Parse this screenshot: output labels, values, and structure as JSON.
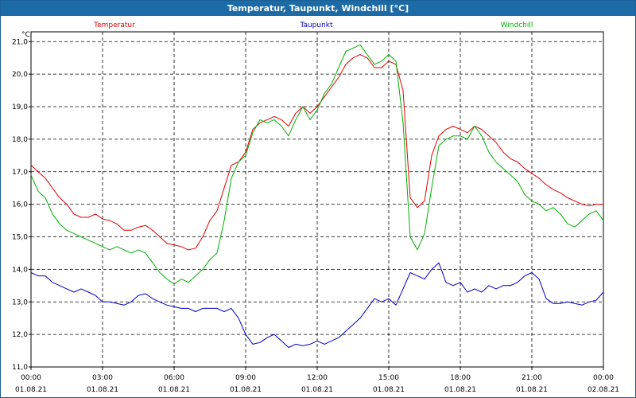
{
  "window": {
    "title": "Temperatur, Taupunkt, Windchill [°C]"
  },
  "chart_data": {
    "type": "line",
    "title": "Temperatur, Taupunkt, Windchill [°C]",
    "ylabel": "°C",
    "xlabel": "",
    "ylim": [
      11.0,
      21.3
    ],
    "xlim_hours": [
      0,
      24
    ],
    "y_ticks": [
      "11,0",
      "12,0",
      "13,0",
      "14,0",
      "15,0",
      "16,0",
      "17,0",
      "18,0",
      "19,0",
      "20,0",
      "21,0"
    ],
    "x_ticks": [
      {
        "time": "00:00",
        "date": "01.08.21"
      },
      {
        "time": "03:00",
        "date": "01.08.21"
      },
      {
        "time": "06:00",
        "date": "01.08.21"
      },
      {
        "time": "09:00",
        "date": "01.08.21"
      },
      {
        "time": "12:00",
        "date": "01.08.21"
      },
      {
        "time": "15:00",
        "date": "01.08.21"
      },
      {
        "time": "18:00",
        "date": "01.08.21"
      },
      {
        "time": "21:00",
        "date": "01.08.21"
      },
      {
        "time": "00:00",
        "date": "02.08.21"
      }
    ],
    "grid": true,
    "legend_placement": "top",
    "series": [
      {
        "name": "Temperatur",
        "color": "#e00000",
        "points": [
          [
            0.0,
            17.2
          ],
          [
            0.3,
            17.0
          ],
          [
            0.6,
            16.8
          ],
          [
            0.9,
            16.5
          ],
          [
            1.2,
            16.2
          ],
          [
            1.5,
            16.0
          ],
          [
            1.8,
            15.7
          ],
          [
            2.1,
            15.6
          ],
          [
            2.4,
            15.6
          ],
          [
            2.7,
            15.7
          ],
          [
            3.0,
            15.55
          ],
          [
            3.3,
            15.5
          ],
          [
            3.6,
            15.4
          ],
          [
            3.9,
            15.2
          ],
          [
            4.2,
            15.2
          ],
          [
            4.5,
            15.3
          ],
          [
            4.8,
            15.35
          ],
          [
            5.1,
            15.2
          ],
          [
            5.4,
            15.0
          ],
          [
            5.7,
            14.8
          ],
          [
            6.0,
            14.75
          ],
          [
            6.3,
            14.7
          ],
          [
            6.6,
            14.6
          ],
          [
            6.9,
            14.65
          ],
          [
            7.2,
            15.0
          ],
          [
            7.5,
            15.5
          ],
          [
            7.8,
            15.8
          ],
          [
            8.1,
            16.5
          ],
          [
            8.4,
            17.2
          ],
          [
            8.7,
            17.3
          ],
          [
            9.0,
            17.6
          ],
          [
            9.3,
            18.3
          ],
          [
            9.6,
            18.5
          ],
          [
            9.9,
            18.6
          ],
          [
            10.2,
            18.7
          ],
          [
            10.5,
            18.6
          ],
          [
            10.8,
            18.4
          ],
          [
            11.1,
            18.8
          ],
          [
            11.4,
            19.0
          ],
          [
            11.7,
            18.8
          ],
          [
            12.0,
            19.0
          ],
          [
            12.3,
            19.3
          ],
          [
            12.6,
            19.6
          ],
          [
            12.9,
            19.9
          ],
          [
            13.2,
            20.3
          ],
          [
            13.5,
            20.5
          ],
          [
            13.8,
            20.6
          ],
          [
            14.1,
            20.5
          ],
          [
            14.4,
            20.2
          ],
          [
            14.7,
            20.2
          ],
          [
            15.0,
            20.4
          ],
          [
            15.3,
            20.3
          ],
          [
            15.6,
            19.5
          ],
          [
            15.9,
            16.2
          ],
          [
            16.2,
            15.9
          ],
          [
            16.5,
            16.1
          ],
          [
            16.8,
            17.5
          ],
          [
            17.1,
            18.1
          ],
          [
            17.4,
            18.3
          ],
          [
            17.7,
            18.4
          ],
          [
            18.0,
            18.3
          ],
          [
            18.3,
            18.2
          ],
          [
            18.6,
            18.4
          ],
          [
            18.9,
            18.3
          ],
          [
            19.2,
            18.1
          ],
          [
            19.5,
            17.9
          ],
          [
            19.8,
            17.6
          ],
          [
            20.1,
            17.4
          ],
          [
            20.4,
            17.3
          ],
          [
            20.7,
            17.1
          ],
          [
            21.0,
            16.95
          ],
          [
            21.3,
            16.8
          ],
          [
            21.6,
            16.6
          ],
          [
            21.9,
            16.45
          ],
          [
            22.2,
            16.35
          ],
          [
            22.5,
            16.2
          ],
          [
            22.8,
            16.1
          ],
          [
            23.1,
            16.0
          ],
          [
            23.4,
            15.95
          ],
          [
            23.7,
            16.0
          ],
          [
            24.0,
            16.0
          ]
        ]
      },
      {
        "name": "Taupunkt",
        "color": "#0000c0",
        "points": [
          [
            0.0,
            13.9
          ],
          [
            0.3,
            13.8
          ],
          [
            0.6,
            13.8
          ],
          [
            0.9,
            13.6
          ],
          [
            1.2,
            13.5
          ],
          [
            1.5,
            13.4
          ],
          [
            1.8,
            13.3
          ],
          [
            2.1,
            13.4
          ],
          [
            2.4,
            13.3
          ],
          [
            2.7,
            13.2
          ],
          [
            3.0,
            13.0
          ],
          [
            3.3,
            13.0
          ],
          [
            3.6,
            12.95
          ],
          [
            3.9,
            12.9
          ],
          [
            4.2,
            13.0
          ],
          [
            4.5,
            13.2
          ],
          [
            4.8,
            13.25
          ],
          [
            5.1,
            13.1
          ],
          [
            5.4,
            13.0
          ],
          [
            5.7,
            12.9
          ],
          [
            6.0,
            12.85
          ],
          [
            6.3,
            12.8
          ],
          [
            6.6,
            12.8
          ],
          [
            6.9,
            12.7
          ],
          [
            7.2,
            12.8
          ],
          [
            7.5,
            12.8
          ],
          [
            7.8,
            12.8
          ],
          [
            8.1,
            12.7
          ],
          [
            8.4,
            12.8
          ],
          [
            8.7,
            12.5
          ],
          [
            9.0,
            12.0
          ],
          [
            9.3,
            11.7
          ],
          [
            9.6,
            11.75
          ],
          [
            9.9,
            11.9
          ],
          [
            10.2,
            12.0
          ],
          [
            10.5,
            11.8
          ],
          [
            10.8,
            11.6
          ],
          [
            11.1,
            11.7
          ],
          [
            11.4,
            11.65
          ],
          [
            11.7,
            11.7
          ],
          [
            12.0,
            11.8
          ],
          [
            12.3,
            11.7
          ],
          [
            12.6,
            11.8
          ],
          [
            12.9,
            11.9
          ],
          [
            13.2,
            12.1
          ],
          [
            13.5,
            12.3
          ],
          [
            13.8,
            12.5
          ],
          [
            14.1,
            12.8
          ],
          [
            14.4,
            13.1
          ],
          [
            14.7,
            13.0
          ],
          [
            15.0,
            13.1
          ],
          [
            15.3,
            12.9
          ],
          [
            15.6,
            13.4
          ],
          [
            15.9,
            13.9
          ],
          [
            16.2,
            13.8
          ],
          [
            16.5,
            13.7
          ],
          [
            16.8,
            14.0
          ],
          [
            17.1,
            14.2
          ],
          [
            17.4,
            13.6
          ],
          [
            17.7,
            13.5
          ],
          [
            18.0,
            13.6
          ],
          [
            18.3,
            13.3
          ],
          [
            18.6,
            13.4
          ],
          [
            18.9,
            13.3
          ],
          [
            19.2,
            13.5
          ],
          [
            19.5,
            13.4
          ],
          [
            19.8,
            13.5
          ],
          [
            20.1,
            13.5
          ],
          [
            20.4,
            13.6
          ],
          [
            20.7,
            13.8
          ],
          [
            21.0,
            13.9
          ],
          [
            21.3,
            13.7
          ],
          [
            21.6,
            13.1
          ],
          [
            21.9,
            12.95
          ],
          [
            22.2,
            12.95
          ],
          [
            22.5,
            13.0
          ],
          [
            22.8,
            12.95
          ],
          [
            23.1,
            12.9
          ],
          [
            23.4,
            13.0
          ],
          [
            23.7,
            13.05
          ],
          [
            24.0,
            13.3
          ]
        ]
      },
      {
        "name": "Windchill",
        "color": "#00b000",
        "points": [
          [
            0.0,
            16.9
          ],
          [
            0.3,
            16.4
          ],
          [
            0.6,
            16.2
          ],
          [
            0.9,
            15.7
          ],
          [
            1.2,
            15.4
          ],
          [
            1.5,
            15.2
          ],
          [
            1.8,
            15.1
          ],
          [
            2.1,
            15.0
          ],
          [
            2.4,
            14.9
          ],
          [
            2.7,
            14.8
          ],
          [
            3.0,
            14.7
          ],
          [
            3.3,
            14.6
          ],
          [
            3.6,
            14.7
          ],
          [
            3.9,
            14.6
          ],
          [
            4.2,
            14.5
          ],
          [
            4.5,
            14.6
          ],
          [
            4.8,
            14.5
          ],
          [
            5.1,
            14.2
          ],
          [
            5.4,
            13.9
          ],
          [
            5.7,
            13.7
          ],
          [
            6.0,
            13.55
          ],
          [
            6.3,
            13.7
          ],
          [
            6.6,
            13.6
          ],
          [
            6.9,
            13.8
          ],
          [
            7.2,
            14.0
          ],
          [
            7.5,
            14.3
          ],
          [
            7.8,
            14.5
          ],
          [
            8.1,
            15.5
          ],
          [
            8.4,
            16.8
          ],
          [
            8.7,
            17.3
          ],
          [
            9.0,
            17.5
          ],
          [
            9.3,
            18.2
          ],
          [
            9.6,
            18.6
          ],
          [
            9.9,
            18.5
          ],
          [
            10.2,
            18.6
          ],
          [
            10.5,
            18.4
          ],
          [
            10.8,
            18.1
          ],
          [
            11.1,
            18.6
          ],
          [
            11.4,
            19.0
          ],
          [
            11.7,
            18.6
          ],
          [
            12.0,
            18.9
          ],
          [
            12.3,
            19.4
          ],
          [
            12.6,
            19.7
          ],
          [
            12.9,
            20.2
          ],
          [
            13.2,
            20.7
          ],
          [
            13.5,
            20.8
          ],
          [
            13.8,
            20.9
          ],
          [
            14.1,
            20.6
          ],
          [
            14.4,
            20.3
          ],
          [
            14.7,
            20.4
          ],
          [
            15.0,
            20.6
          ],
          [
            15.3,
            20.4
          ],
          [
            15.6,
            18.5
          ],
          [
            15.9,
            15.0
          ],
          [
            16.2,
            14.6
          ],
          [
            16.5,
            15.1
          ],
          [
            16.8,
            16.5
          ],
          [
            17.1,
            17.8
          ],
          [
            17.4,
            18.0
          ],
          [
            17.7,
            18.1
          ],
          [
            18.0,
            18.1
          ],
          [
            18.3,
            18.0
          ],
          [
            18.6,
            18.4
          ],
          [
            18.9,
            18.1
          ],
          [
            19.2,
            17.6
          ],
          [
            19.5,
            17.3
          ],
          [
            19.8,
            17.1
          ],
          [
            20.1,
            16.9
          ],
          [
            20.4,
            16.7
          ],
          [
            20.7,
            16.3
          ],
          [
            21.0,
            16.1
          ],
          [
            21.3,
            16.0
          ],
          [
            21.6,
            15.8
          ],
          [
            21.9,
            15.9
          ],
          [
            22.2,
            15.7
          ],
          [
            22.5,
            15.4
          ],
          [
            22.8,
            15.3
          ],
          [
            23.1,
            15.5
          ],
          [
            23.4,
            15.7
          ],
          [
            23.7,
            15.8
          ],
          [
            24.0,
            15.5
          ]
        ]
      }
    ]
  }
}
